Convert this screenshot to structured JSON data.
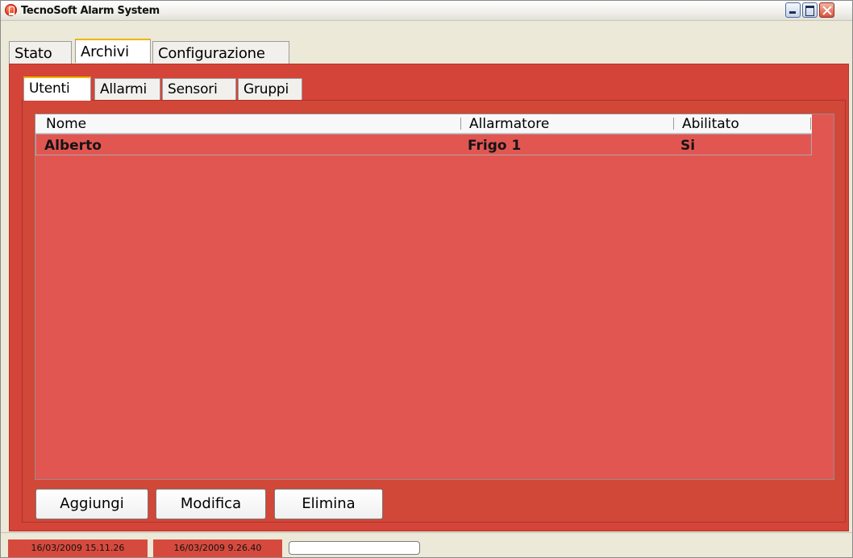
{
  "window": {
    "title": "TecnoSoft Alarm System",
    "icon": "alarm-app-icon",
    "controls": [
      "minimize",
      "maximize",
      "close"
    ]
  },
  "main_tabs": [
    {
      "label": "Stato",
      "active": false
    },
    {
      "label": "Archivi",
      "active": true
    },
    {
      "label": "Configurazione",
      "active": false
    }
  ],
  "archive_tabs": [
    {
      "label": "Utenti",
      "active": true
    },
    {
      "label": "Allarmi",
      "active": false
    },
    {
      "label": "Sensori",
      "active": false
    },
    {
      "label": "Gruppi",
      "active": false
    }
  ],
  "users_table": {
    "columns": [
      "Nome",
      "Allarmatore",
      "Abilitato"
    ],
    "rows": [
      [
        "Alberto",
        "Frigo 1",
        "Si"
      ]
    ]
  },
  "actions": {
    "add": "Aggiungi",
    "edit": "Modifica",
    "delete": "Elimina"
  },
  "status": {
    "time1": "16/03/2009 15.11.26",
    "time2": "16/03/2009 9.26.40",
    "progress": 0
  },
  "colors": {
    "panel_red": "#d44438",
    "table_red": "#e25652",
    "active_tab_accent": "#f0b400"
  }
}
